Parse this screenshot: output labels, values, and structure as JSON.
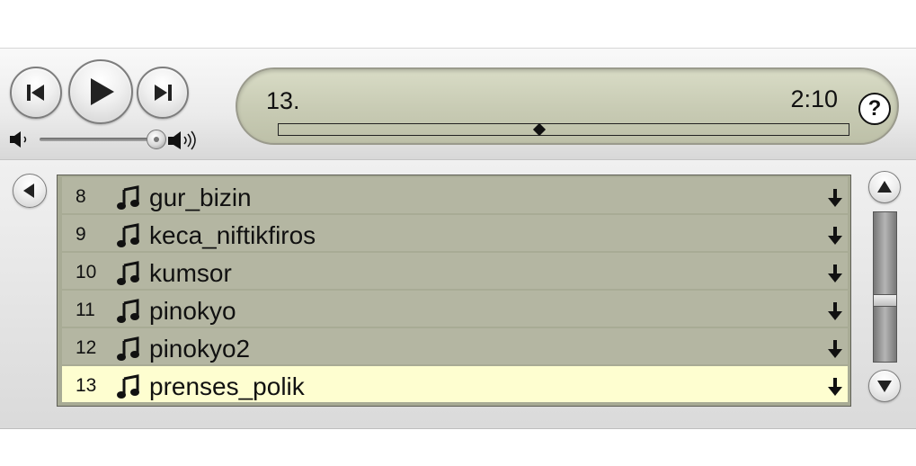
{
  "display": {
    "track_number": "13.",
    "time": "2:10",
    "progress_fraction": 0.457,
    "help_label": "?"
  },
  "volume": {
    "level": 0.97
  },
  "playlist": {
    "tracks": [
      {
        "index": "8",
        "title": "gur_bizin",
        "selected": false
      },
      {
        "index": "9",
        "title": "keca_niftikfiros",
        "selected": false
      },
      {
        "index": "10",
        "title": "kumsor",
        "selected": false
      },
      {
        "index": "11",
        "title": "pinokyo",
        "selected": false
      },
      {
        "index": "12",
        "title": "pinokyo2",
        "selected": false
      },
      {
        "index": "13",
        "title": "prenses_polik",
        "selected": true
      }
    ]
  },
  "scrollbar": {
    "position": 0.6
  },
  "icons": {
    "previous": "previous-track-icon",
    "play": "play-icon",
    "next": "next-track-icon",
    "volume_low": "volume-low-icon",
    "volume_high": "volume-high-icon",
    "back": "back-arrow-icon",
    "track": "music-note-icon",
    "download": "download-arrow-icon",
    "scroll_up": "scroll-up-icon",
    "scroll_down": "scroll-down-icon"
  },
  "colors": {
    "display_bg": "#c9ccb5",
    "row_bg": "#b4b6a2",
    "selected_row_bg": "#fefed0"
  }
}
